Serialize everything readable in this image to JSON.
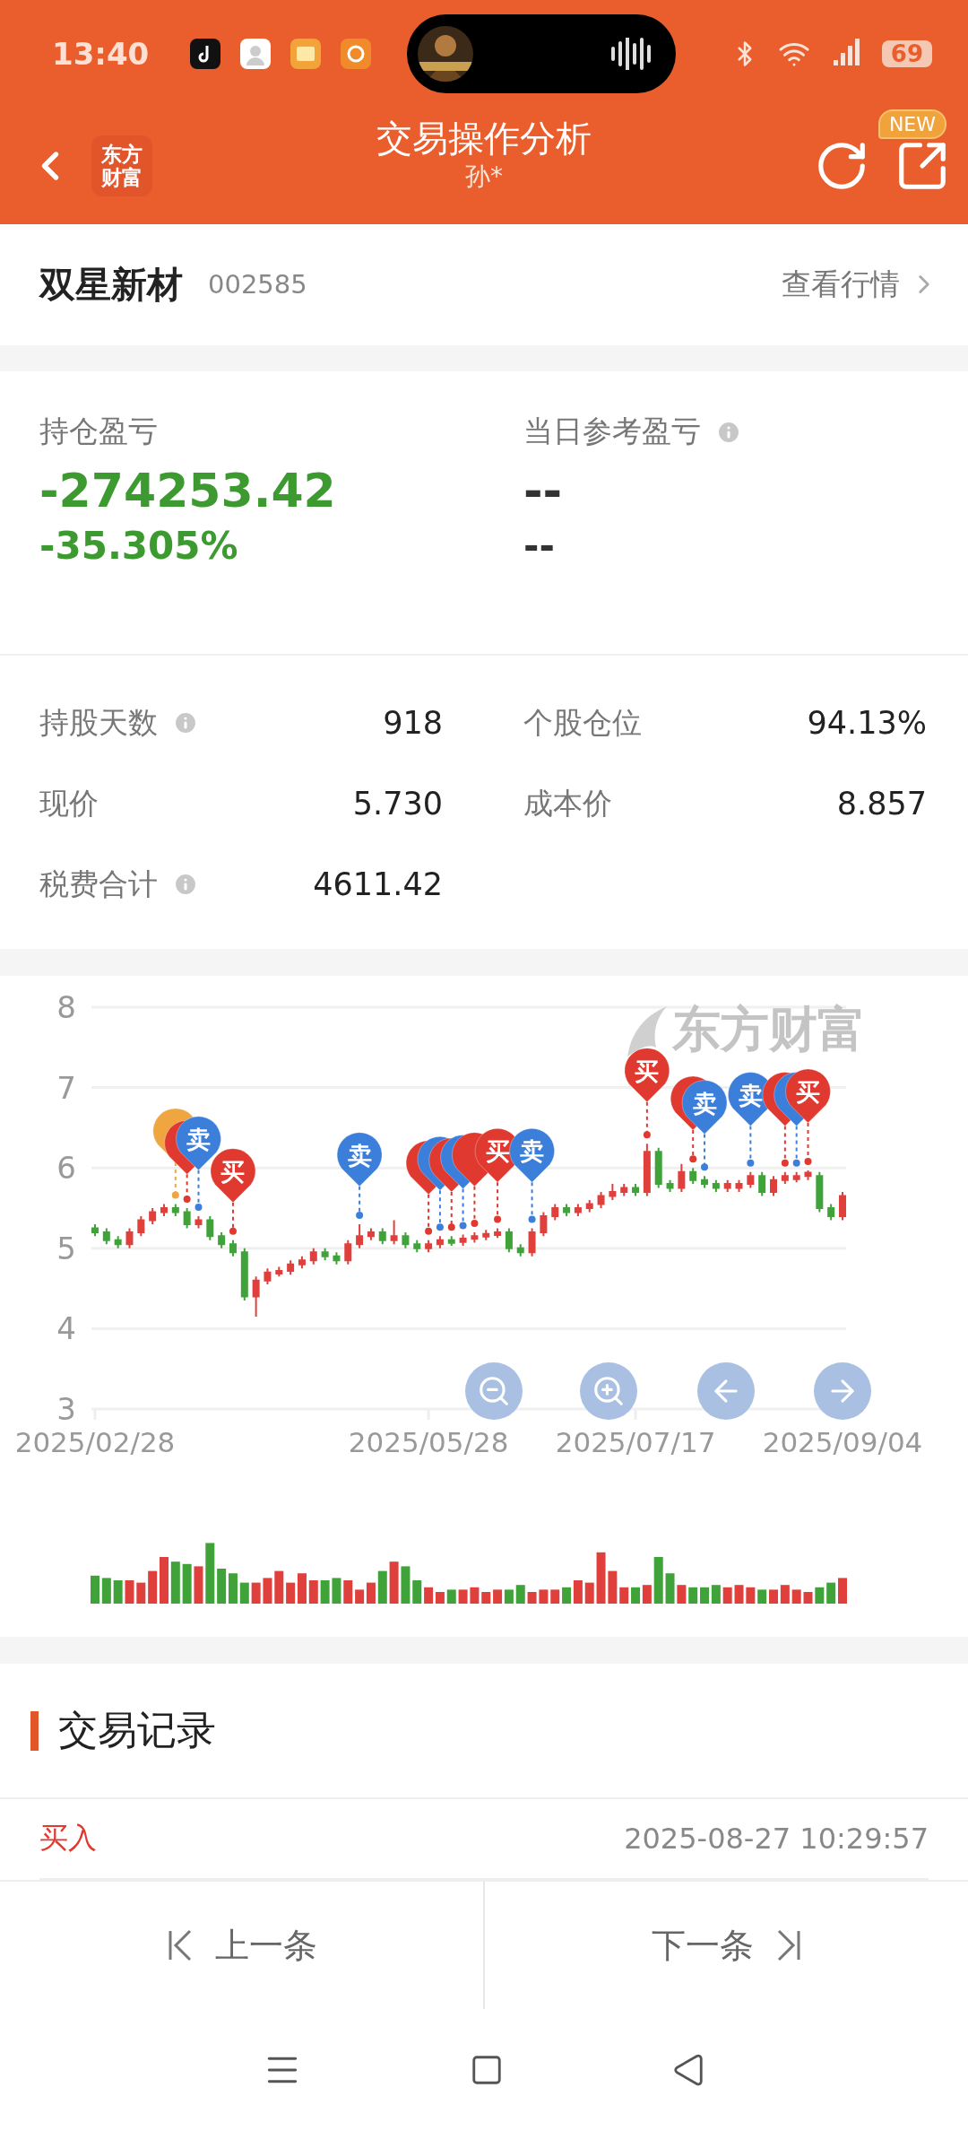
{
  "status_bar": {
    "time": "13:40",
    "battery": "69"
  },
  "header": {
    "logo_lines": [
      "东方",
      "财富"
    ],
    "title": "交易操作分析",
    "subtitle": "孙*",
    "badge": "NEW"
  },
  "stock": {
    "name": "双星新材",
    "code": "002585",
    "link": "查看行情"
  },
  "pnl": [
    {
      "label": "持仓盈亏",
      "info": false,
      "kind": "loss",
      "values": [
        "-274253.42",
        "-35.305%"
      ]
    },
    {
      "label": "当日参考盈亏",
      "info": true,
      "kind": "neutral",
      "values": [
        "--",
        "--"
      ]
    }
  ],
  "stats": [
    {
      "label": "持股天数",
      "info": true,
      "value": "918"
    },
    {
      "label": "个股仓位",
      "info": false,
      "value": "94.13%"
    },
    {
      "label": "现价",
      "info": false,
      "value": "5.730"
    },
    {
      "label": "成本价",
      "info": false,
      "value": "8.857"
    },
    {
      "label": "税费合计",
      "info": true,
      "value": "4611.42"
    }
  ],
  "chart": {
    "watermark": "东方财富",
    "chart_data": {
      "type": "candlestick",
      "grid": true,
      "ylim": [
        3,
        8
      ],
      "yticks": [
        3,
        4,
        5,
        6,
        7,
        8
      ],
      "categories": [
        "2025/02/28",
        null,
        null,
        null,
        null,
        null,
        null,
        null,
        null,
        null,
        null,
        null,
        null,
        null,
        null,
        null,
        null,
        null,
        null,
        null,
        null,
        null,
        null,
        null,
        null,
        null,
        null,
        null,
        null,
        "2025/05/28",
        null,
        null,
        null,
        null,
        null,
        null,
        null,
        null,
        null,
        null,
        null,
        null,
        null,
        null,
        null,
        null,
        null,
        "2025/07/17",
        null,
        null,
        null,
        null,
        null,
        null,
        null,
        null,
        null,
        null,
        null,
        null,
        null,
        null,
        null,
        null,
        null,
        "2025/09/04"
      ],
      "ohlc": [
        [
          5.25,
          5.3,
          5.15,
          5.2
        ],
        [
          5.2,
          5.25,
          5.05,
          5.1
        ],
        [
          5.1,
          5.15,
          5.0,
          5.05
        ],
        [
          5.05,
          5.25,
          5.0,
          5.2
        ],
        [
          5.2,
          5.4,
          5.15,
          5.35
        ],
        [
          5.35,
          5.5,
          5.3,
          5.45
        ],
        [
          5.45,
          5.55,
          5.4,
          5.5
        ],
        [
          5.5,
          5.55,
          5.4,
          5.45
        ],
        [
          5.45,
          5.5,
          5.25,
          5.3
        ],
        [
          5.3,
          5.4,
          5.25,
          5.35
        ],
        [
          5.35,
          5.4,
          5.1,
          5.15
        ],
        [
          5.15,
          5.2,
          5.0,
          5.05
        ],
        [
          5.05,
          5.1,
          4.9,
          4.95
        ],
        [
          4.95,
          5.0,
          4.35,
          4.4
        ],
        [
          4.4,
          4.65,
          4.15,
          4.6
        ],
        [
          4.6,
          4.75,
          4.55,
          4.7
        ],
        [
          4.7,
          4.77,
          4.65,
          4.72
        ],
        [
          4.72,
          4.85,
          4.67,
          4.8
        ],
        [
          4.8,
          4.9,
          4.75,
          4.85
        ],
        [
          4.85,
          5.0,
          4.8,
          4.95
        ],
        [
          4.95,
          5.0,
          4.85,
          4.9
        ],
        [
          4.9,
          4.95,
          4.8,
          4.85
        ],
        [
          4.85,
          5.1,
          4.8,
          5.05
        ],
        [
          5.05,
          5.3,
          5.0,
          5.15
        ],
        [
          5.15,
          5.25,
          5.1,
          5.2
        ],
        [
          5.2,
          5.25,
          5.05,
          5.1
        ],
        [
          5.1,
          5.35,
          5.05,
          5.15
        ],
        [
          5.15,
          5.2,
          5.0,
          5.05
        ],
        [
          5.05,
          5.1,
          4.95,
          5.0
        ],
        [
          5.0,
          5.1,
          4.95,
          5.05
        ],
        [
          5.05,
          5.15,
          5.0,
          5.1
        ],
        [
          5.1,
          5.15,
          5.03,
          5.08
        ],
        [
          5.08,
          5.17,
          5.03,
          5.12
        ],
        [
          5.12,
          5.2,
          5.07,
          5.15
        ],
        [
          5.15,
          5.23,
          5.1,
          5.18
        ],
        [
          5.18,
          5.25,
          5.13,
          5.2
        ],
        [
          5.2,
          5.25,
          4.95,
          5.0
        ],
        [
          5.0,
          5.05,
          4.9,
          4.95
        ],
        [
          4.95,
          5.25,
          4.9,
          5.2
        ],
        [
          5.2,
          5.45,
          5.15,
          5.4
        ],
        [
          5.4,
          5.55,
          5.35,
          5.5
        ],
        [
          5.5,
          5.55,
          5.4,
          5.45
        ],
        [
          5.45,
          5.55,
          5.4,
          5.5
        ],
        [
          5.5,
          5.6,
          5.45,
          5.55
        ],
        [
          5.55,
          5.7,
          5.5,
          5.65
        ],
        [
          5.65,
          5.8,
          5.6,
          5.7
        ],
        [
          5.7,
          5.8,
          5.65,
          5.75
        ],
        [
          5.75,
          5.8,
          5.65,
          5.7
        ],
        [
          5.7,
          6.3,
          5.65,
          6.2
        ],
        [
          6.2,
          6.25,
          5.75,
          5.8
        ],
        [
          5.8,
          5.85,
          5.7,
          5.75
        ],
        [
          5.75,
          6.05,
          5.7,
          5.95
        ],
        [
          5.95,
          6.0,
          5.8,
          5.85
        ],
        [
          5.85,
          5.9,
          5.75,
          5.8
        ],
        [
          5.8,
          5.85,
          5.7,
          5.75
        ],
        [
          5.75,
          5.85,
          5.7,
          5.8
        ],
        [
          5.75,
          5.85,
          5.7,
          5.8
        ],
        [
          5.8,
          5.95,
          5.75,
          5.9
        ],
        [
          5.9,
          5.95,
          5.65,
          5.7
        ],
        [
          5.7,
          5.9,
          5.65,
          5.85
        ],
        [
          5.85,
          5.95,
          5.8,
          5.9
        ],
        [
          5.86,
          5.95,
          5.82,
          5.9
        ],
        [
          5.9,
          5.97,
          5.85,
          5.94
        ],
        [
          5.9,
          5.95,
          5.45,
          5.5
        ],
        [
          5.5,
          5.55,
          5.35,
          5.4
        ],
        [
          5.4,
          5.7,
          5.35,
          5.65
        ]
      ]
    },
    "markers": [
      {
        "kind": "first"
      },
      {
        "kind": "buy"
      },
      {
        "kind": "sell",
        "text": "卖"
      },
      {
        "kind": "buy",
        "text": "买"
      },
      {
        "kind": "sell",
        "text": "卖"
      },
      {
        "kind": "buy"
      },
      {
        "kind": "sell"
      },
      {
        "kind": "buy"
      },
      {
        "kind": "sell"
      },
      {
        "kind": "buy"
      },
      {
        "kind": "buy",
        "text": "买"
      },
      {
        "kind": "sell",
        "text": "卖"
      },
      {
        "kind": "buy",
        "text": "买"
      },
      {
        "kind": "buy"
      },
      {
        "kind": "sell",
        "text": "卖"
      },
      {
        "kind": "sell",
        "text": "卖"
      },
      {
        "kind": "buy"
      },
      {
        "kind": "sell"
      },
      {
        "kind": "buy",
        "text": "买"
      }
    ]
  },
  "records": {
    "title": "交易记录",
    "rows": [
      {
        "action": "买入",
        "kind": "buy",
        "time": "2025-08-27 10:29:57"
      }
    ]
  },
  "pager": {
    "prev": "上一条",
    "next": "下一条"
  }
}
